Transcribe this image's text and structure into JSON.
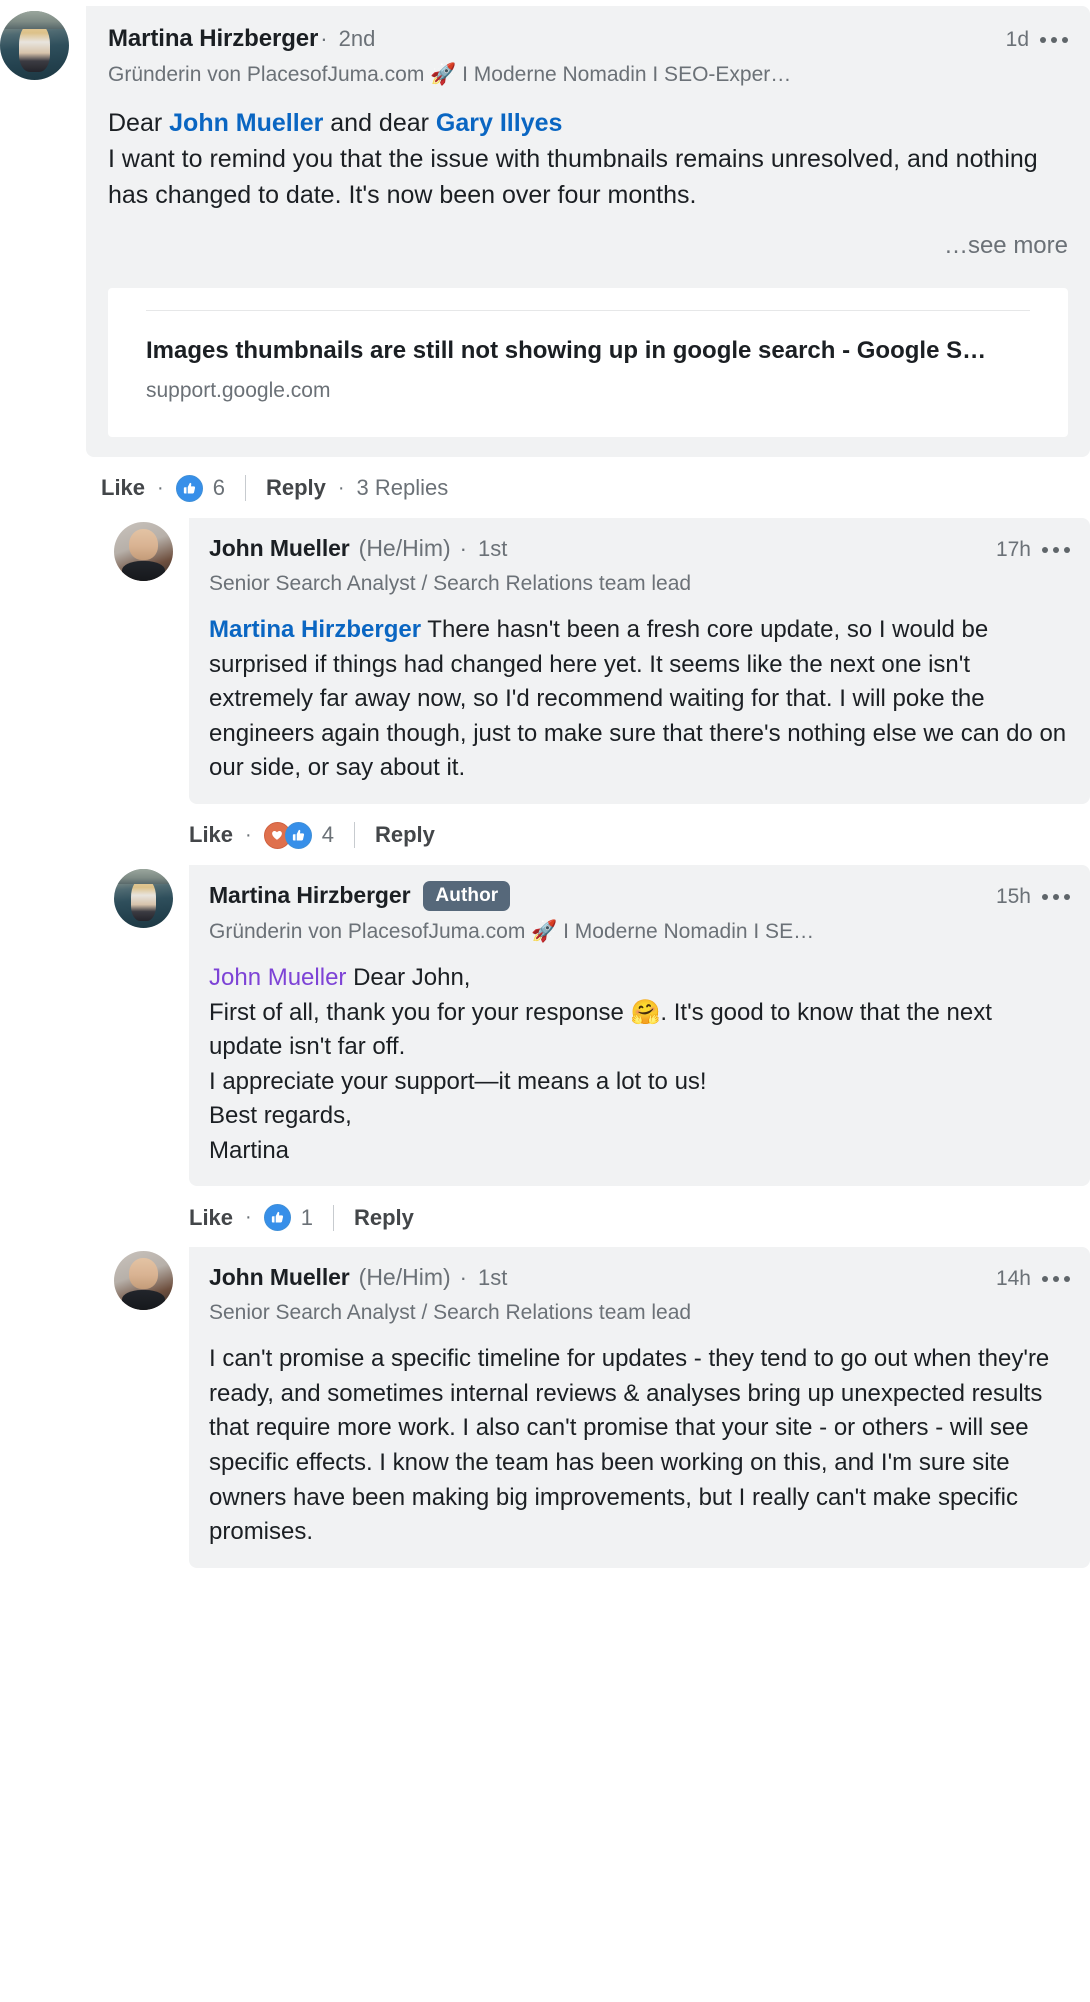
{
  "thread": {
    "root_comment": {
      "author_name": "Martina Hirzberger",
      "degree": "2nd",
      "separator": "·",
      "headline": "Gründerin von PlacesofJuma.com 🚀 I Moderne Nomadin I SEO-Exper…",
      "timestamp": "1d",
      "body_prefix": "Dear ",
      "mention_one": "John Mueller",
      "body_middle": " and dear ",
      "mention_two": "Gary Illyes",
      "body_rest": "\nI want to remind you that the issue with thumbnails remains unresolved, and nothing has changed to date. It's now been over four months.",
      "see_more": "…see more",
      "link_card": {
        "title": "Images thumbnails are still not showing up in google search - Google S…",
        "domain": "support.google.com"
      },
      "actions": {
        "like_label": "Like",
        "dot": "·",
        "reaction_count": "6",
        "reactions": [
          "like-reaction-icon"
        ],
        "reply_label": "Reply",
        "replies_label": "3 Replies"
      }
    },
    "replies": [
      {
        "author_name": "John Mueller",
        "pronouns": "(He/Him)",
        "degree": "1st",
        "separator": "·",
        "headline": "Senior Search Analyst / Search Relations team lead",
        "timestamp": "17h",
        "mention": "Martina Hirzberger",
        "mention_style": "blue",
        "body": " There hasn't been a fresh core update, so I would be surprised if things had changed here yet. It seems like the next one isn't extremely far away now, so I'd recommend waiting for that. I will poke the engineers again though, just to make sure that there's nothing else we can do on our side, or say about it.",
        "actions": {
          "like_label": "Like",
          "dot": "·",
          "reaction_count": "4",
          "reactions": [
            "love-reaction-icon",
            "like-reaction-icon"
          ],
          "reply_label": "Reply"
        }
      },
      {
        "author_name": "Martina Hirzberger",
        "badge": "Author",
        "headline": "Gründerin von PlacesofJuma.com 🚀 I Moderne Nomadin I SE…",
        "timestamp": "15h",
        "mention": "John Mueller",
        "mention_style": "purple",
        "body": " Dear John,\nFirst of all, thank you for your response 🤗. It's good to know that the next update isn't far off.\nI appreciate your support—it means a lot to us!\nBest regards,\nMartina",
        "actions": {
          "like_label": "Like",
          "dot": "·",
          "reaction_count": "1",
          "reactions": [
            "like-reaction-icon"
          ],
          "reply_label": "Reply"
        }
      },
      {
        "author_name": "John Mueller",
        "pronouns": "(He/Him)",
        "degree": "1st",
        "separator": "·",
        "headline": "Senior Search Analyst / Search Relations team lead",
        "timestamp": "14h",
        "mention": "",
        "mention_style": "none",
        "body": "I can't promise a specific timeline for updates - they tend to go out when they're ready, and sometimes internal reviews & analyses bring up unexpected results that require more work. I also can't promise that your site - or others - will see specific effects. I know the team has been working on this, and I'm sure site owners have been making big improvements, but I really can't make specific promises.",
        "actions": {
          "like_label": "Like",
          "dot": "·",
          "reaction_count": "",
          "reactions": [],
          "reply_label": "Reply"
        }
      }
    ]
  },
  "colors": {
    "mention_blue": "#0a66c2",
    "mention_purple": "#7d43d6",
    "bubble_bg": "#f1f2f3",
    "text_primary": "#1b1f23",
    "text_secondary": "#6b7177",
    "author_badge_bg": "#56687a",
    "reaction_like_blue": "#378fe9",
    "reaction_love_red": "#df704d"
  }
}
